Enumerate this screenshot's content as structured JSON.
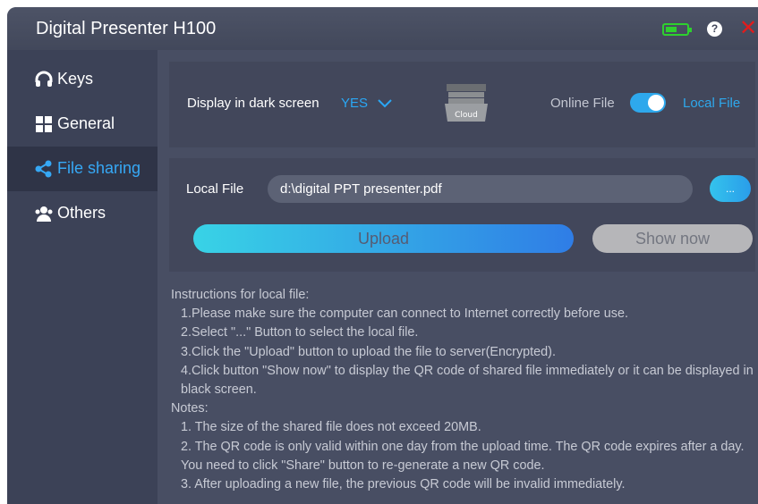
{
  "window": {
    "title": "Digital Presenter H100",
    "icons": {
      "battery": "battery-icon",
      "help": "help-icon",
      "close": "close-icon"
    },
    "colors": {
      "accent": "#2ea8ec",
      "battery": "#2ed12e",
      "close": "#e21c1c"
    }
  },
  "help_glyph": "?",
  "close_glyph": "✕",
  "sidebar": {
    "items": [
      {
        "label": "Keys",
        "icon": "headset-icon",
        "active": false
      },
      {
        "label": "General",
        "icon": "grid-icon",
        "active": false
      },
      {
        "label": "File sharing",
        "icon": "share-icon",
        "active": true
      },
      {
        "label": "Others",
        "icon": "users-icon",
        "active": false
      }
    ]
  },
  "display_panel": {
    "dark_screen_label": "Display in dark screen",
    "dark_screen_value": "YES",
    "cloud_label": "Cloud",
    "online_label": "Online File",
    "local_label": "Local File",
    "toggle_state": "local"
  },
  "file_panel": {
    "local_file_label": "Local File",
    "file_path": "d:\\digital PPT presenter.pdf",
    "browse_label": "...",
    "upload_label": "Upload",
    "show_now_label": "Show now"
  },
  "instructions": {
    "heading": "Instructions for local file:",
    "steps": [
      "1.Please make sure the computer can connect to Internet correctly before use.",
      "2.Select \"...\" Button to select the local file.",
      "3.Click the \"Upload\" button to upload the file to server(Encrypted).",
      "4.Click button \"Show now\" to display the QR code of shared file immediately or it can be displayed in black screen."
    ],
    "notes_heading": "Notes:",
    "notes": [
      "1. The size of the shared file does not exceed 20MB.",
      "2. The QR code is only valid within one day from the upload time. The QR code expires after a day. You need to click \"Share\" button to re-generate a new QR code.",
      "3. After uploading a new file, the previous QR code will be invalid immediately."
    ]
  }
}
